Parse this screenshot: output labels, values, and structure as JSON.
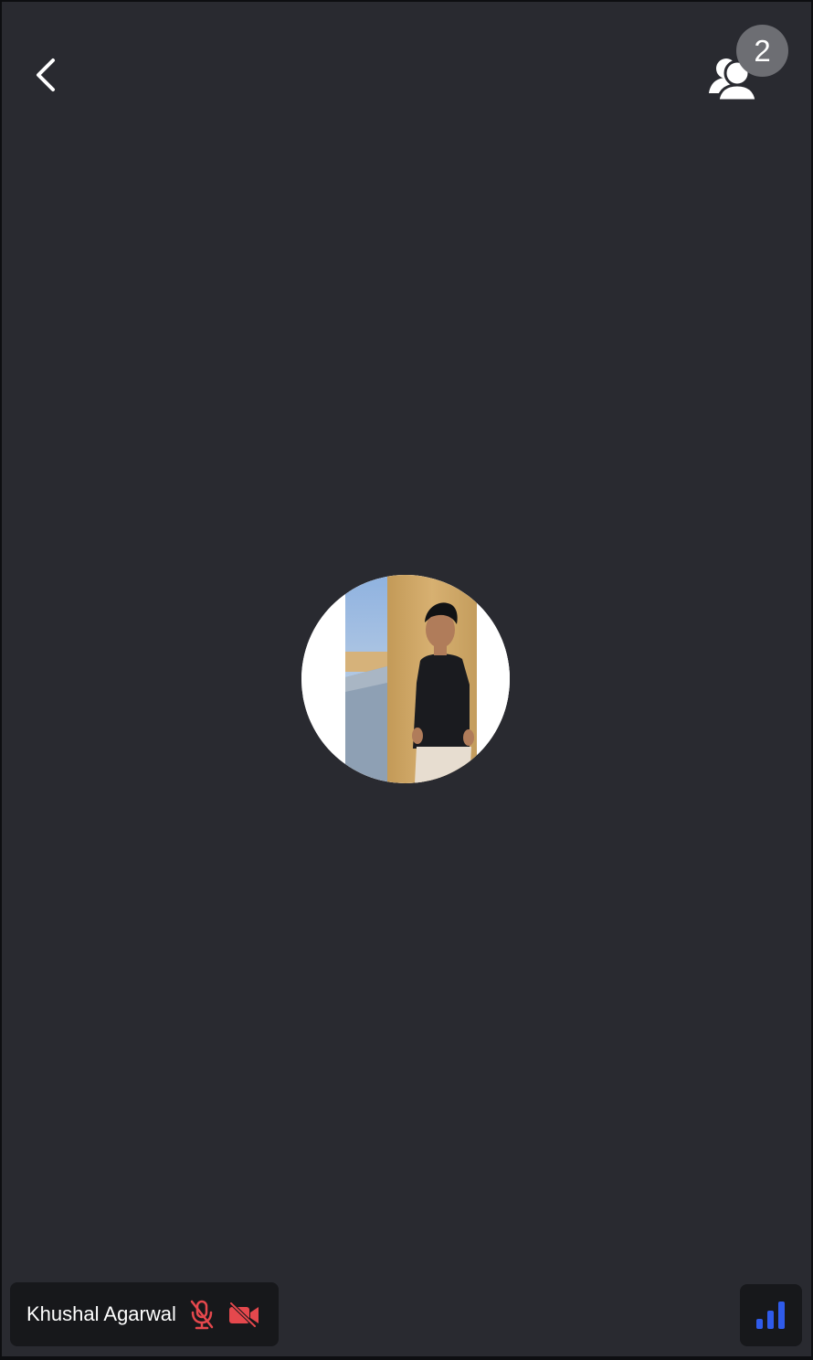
{
  "header": {
    "back_icon": "chevron-left-icon",
    "participants_icon": "people-icon",
    "participant_count": "2"
  },
  "tile": {
    "avatar": "profile-photo",
    "participant_name": "Khushal Agarwal",
    "mic_icon": "microphone-off-icon",
    "camera_icon": "video-off-icon",
    "muted_color": "#e5484d"
  },
  "network": {
    "icon": "signal-bars-icon",
    "color": "#2f5bea"
  },
  "colors": {
    "background": "#292a30",
    "pill": "#17181b",
    "badge": "#6d6e73"
  }
}
